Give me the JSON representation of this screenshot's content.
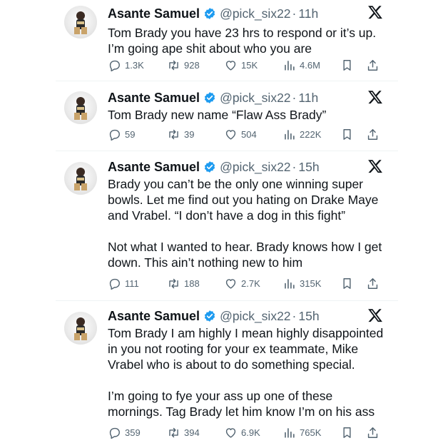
{
  "tweets": [
    {
      "author": "Asante Samuel",
      "handle": "@pick_six22",
      "separator": "·",
      "time": "11h",
      "text": "Tom Brady you have 23 hrs to respond or it’s up.\nI’m going ape shit about who you are",
      "replies": "1.3K",
      "reposts": "928",
      "likes": "15K",
      "views": "4.6M"
    },
    {
      "author": "Asante Samuel",
      "handle": "@pick_six22",
      "separator": "·",
      "time": "11h",
      "text": "Tom Brady new name “Flaw Ass Brady”",
      "replies": "59",
      "reposts": "39",
      "likes": "504",
      "views": "222K"
    },
    {
      "author": "Asante Samuel",
      "handle": "@pick_six22",
      "separator": "·",
      "time": "15h",
      "text": "Brady you can’t be the only one winning super\nbowls. Let me find out you hating on Drake Maye\nand Vrabel. “I don’t have a dog in this fight”\n\nNot what I wanted to hear. Brady knows how I get\ndown. This ain’t nothing new to him",
      "replies": "111",
      "reposts": "188",
      "likes": "2.7K",
      "views": "315K"
    },
    {
      "author": "Asante Samuel",
      "handle": "@pick_six22",
      "separator": "·",
      "time": "15h",
      "text": "Tom Brady I am highly I mean highly disappointed\nin you not rooting for your ex teammate, Mike\nVrabel who is about to do something special.\n\nI’m going to fye your ass up one of these\nmornings. Tag Brady let him know I’m on his ass",
      "replies": "359",
      "reposts": "394",
      "likes": "6.9K",
      "views": "765K"
    }
  ],
  "icons": {
    "verified": "verified-badge-icon",
    "platform": "x-logo-icon",
    "reply": "reply-icon",
    "repost": "repost-icon",
    "like": "like-icon",
    "views": "views-icon",
    "bookmark": "bookmark-icon",
    "share": "share-icon"
  },
  "colors": {
    "verified": "#1d9bf0",
    "text": "#0f1419",
    "secondary": "#536471",
    "divider": "#eff3f4"
  }
}
